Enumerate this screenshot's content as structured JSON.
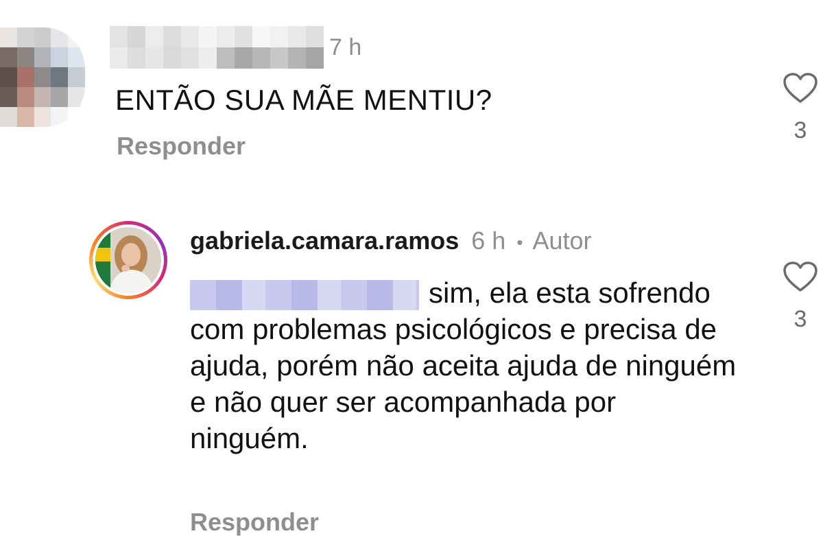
{
  "comments": [
    {
      "time": "7 h",
      "text": "ENTÃO SUA MÃE MENTIU?",
      "reply_label": "Responder",
      "like_count": "3"
    },
    {
      "username": "gabriela.camara.ramos",
      "time": "6 h",
      "separator": "•",
      "author_badge": "Autor",
      "text": "sim, ela esta sofrendo com problemas psicológicos e precisa de ajuda, porém não aceita ajuda de ninguém e não quer ser acompanhada por ninguém.",
      "reply_label": "Responder",
      "like_count": "3"
    }
  ],
  "icons": {
    "like": "heart-outline-icon"
  },
  "colors": {
    "muted": "#8e8e8e",
    "text": "#111111",
    "ring_start": "#d62976",
    "ring_end": "#feda75"
  }
}
